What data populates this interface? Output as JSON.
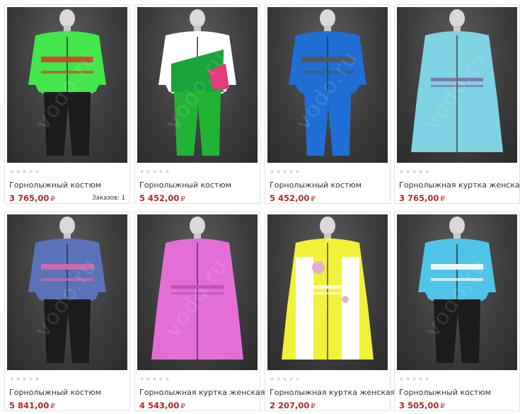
{
  "products": [
    {
      "title": "Горнолыжный костюм",
      "price": "3 765,00",
      "currency": "₽",
      "orders": "Заказов: 1",
      "rating": 0,
      "jacket": "#43e64b",
      "accent": "#d63b2b",
      "pants": "#1b1b1b",
      "kind": "suit"
    },
    {
      "title": "Горнолыжный костюм",
      "price": "5 452,00",
      "currency": "₽",
      "orders": "",
      "rating": 0,
      "jacket": "#ffffff",
      "accent": "#19a33a",
      "pants": "#21b333",
      "kind": "suit2"
    },
    {
      "title": "Горнолыжный костюм",
      "price": "5 452,00",
      "currency": "₽",
      "orders": "",
      "rating": 0,
      "jacket": "#1f6fd6",
      "accent": "#555555",
      "pants": "#1f6fd6",
      "kind": "suit"
    },
    {
      "title": "Горнолыжная куртка женская",
      "price": "3 765,00",
      "currency": "₽",
      "orders": "",
      "rating": 0,
      "jacket": "#7fd3e3",
      "accent": "#7a5fa0",
      "pants": "",
      "kind": "jacket"
    },
    {
      "title": "Горнолыжный костюм",
      "price": "5 841,00",
      "currency": "₽",
      "orders": "",
      "rating": 0,
      "jacket": "#5a72b8",
      "accent": "#d66aa8",
      "pants": "#1b1b1b",
      "kind": "suit"
    },
    {
      "title": "Горнолыжная куртка женская",
      "price": "4 543,00",
      "currency": "₽",
      "orders": "",
      "rating": 0,
      "jacket": "#e36fd6",
      "accent": "#b24fb0",
      "pants": "",
      "kind": "jacket"
    },
    {
      "title": "Горнолыжная куртка женская",
      "price": "2 207,00",
      "currency": "₽",
      "orders": "",
      "rating": 0,
      "jacket": "#f2f13a",
      "accent": "#ffffff",
      "pants": "",
      "kind": "jacket2"
    },
    {
      "title": "Горнолыжный костюм",
      "price": "3 505,00",
      "currency": "₽",
      "orders": "",
      "rating": 0,
      "jacket": "#4fc4e8",
      "accent": "#ffffff",
      "pants": "#1b1b1b",
      "kind": "suit"
    }
  ],
  "watermark": "vodo.ru"
}
